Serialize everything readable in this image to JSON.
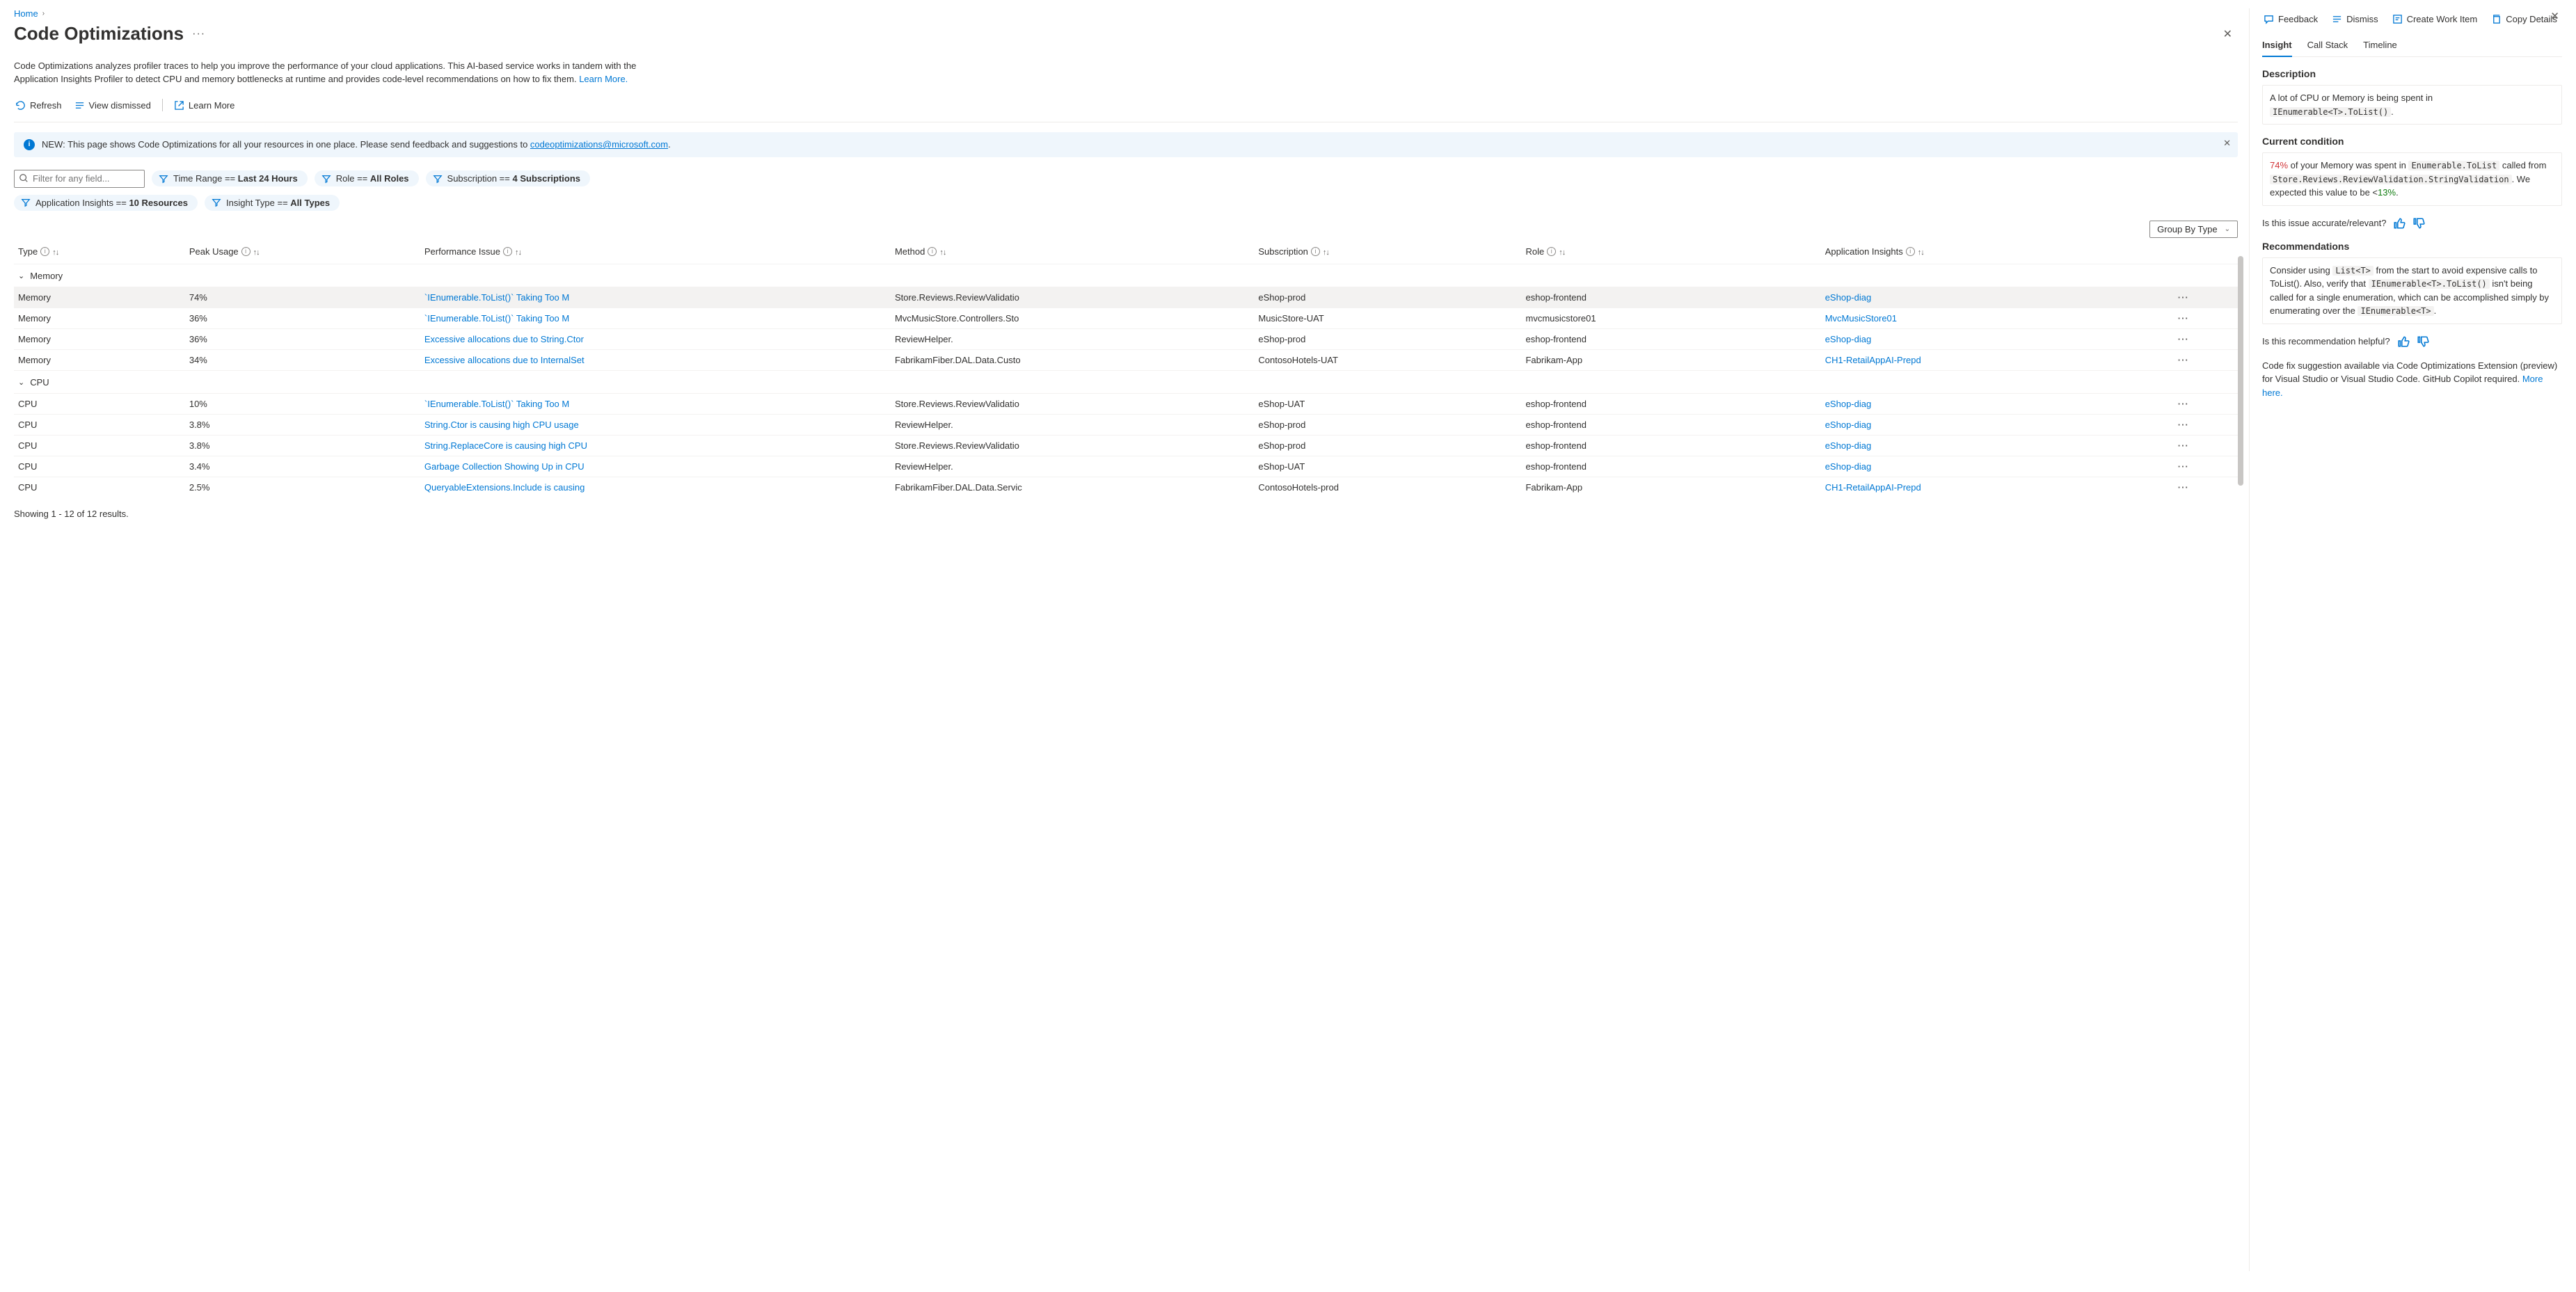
{
  "breadcrumb": {
    "home": "Home"
  },
  "title": "Code Optimizations",
  "intro_text": "Code Optimizations analyzes profiler traces to help you improve the performance of your cloud applications. This AI-based service works in tandem with the Application Insights Profiler to detect CPU and memory bottlenecks at runtime and provides code-level recommendations on how to fix them.",
  "learn_more": "Learn More.",
  "toolbar": {
    "refresh": "Refresh",
    "view_dismissed": "View dismissed",
    "learn_more": "Learn More"
  },
  "banner": {
    "prefix": "NEW: This page shows Code Optimizations for all your resources in one place. Please send feedback and suggestions to ",
    "email": "codeoptimizations@microsoft.com",
    "suffix": "."
  },
  "filters": {
    "search_placeholder": "Filter for any field...",
    "time_range_label": "Time Range ==",
    "time_range_value": "Last 24 Hours",
    "role_label": "Role ==",
    "role_value": "All Roles",
    "subscription_label": "Subscription ==",
    "subscription_value": "4 Subscriptions",
    "appinsights_label": "Application Insights ==",
    "appinsights_value": "10 Resources",
    "insight_type_label": "Insight Type ==",
    "insight_type_value": "All Types"
  },
  "group_by": "Group By Type",
  "columns": {
    "type": "Type",
    "peak": "Peak Usage",
    "issue": "Performance Issue",
    "method": "Method",
    "subscription": "Subscription",
    "role": "Role",
    "appinsights": "Application Insights"
  },
  "groups": {
    "memory": "Memory",
    "cpu": "CPU"
  },
  "rows_memory": [
    {
      "type": "Memory",
      "peak": "74%",
      "issue": "`IEnumerable<T>.ToList()` Taking Too M",
      "method": "Store.Reviews.ReviewValidatio",
      "sub": "eShop-prod",
      "role": "eshop-frontend",
      "ai": "eShop-diag"
    },
    {
      "type": "Memory",
      "peak": "36%",
      "issue": "`IEnumerable<T>.ToList()` Taking Too M",
      "method": "MvcMusicStore.Controllers.Sto",
      "sub": "MusicStore-UAT",
      "role": "mvcmusicstore01",
      "ai": "MvcMusicStore01"
    },
    {
      "type": "Memory",
      "peak": "36%",
      "issue": "Excessive allocations due to String.Ctor",
      "method": "ReviewHelper.<LoadDisallowe",
      "sub": "eShop-prod",
      "role": "eshop-frontend",
      "ai": "eShop-diag"
    },
    {
      "type": "Memory",
      "peak": "34%",
      "issue": "Excessive allocations due to InternalSet",
      "method": "FabrikamFiber.DAL.Data.Custo",
      "sub": "ContosoHotels-UAT",
      "role": "Fabrikam-App",
      "ai": "CH1-RetailAppAI-Prepd"
    }
  ],
  "rows_cpu": [
    {
      "type": "CPU",
      "peak": "10%",
      "issue": "`IEnumerable<T>.ToList()` Taking Too M",
      "method": "Store.Reviews.ReviewValidatio",
      "sub": "eShop-UAT",
      "role": "eshop-frontend",
      "ai": "eShop-diag"
    },
    {
      "type": "CPU",
      "peak": "3.8%",
      "issue": "String.Ctor is causing high CPU usage",
      "method": "ReviewHelper.<LoadDisallowe",
      "sub": "eShop-prod",
      "role": "eshop-frontend",
      "ai": "eShop-diag"
    },
    {
      "type": "CPU",
      "peak": "3.8%",
      "issue": "String.ReplaceCore is causing high CPU",
      "method": "Store.Reviews.ReviewValidatio",
      "sub": "eShop-prod",
      "role": "eshop-frontend",
      "ai": "eShop-diag"
    },
    {
      "type": "CPU",
      "peak": "3.4%",
      "issue": "Garbage Collection Showing Up in CPU",
      "method": "ReviewHelper.<LoadDisallowe",
      "sub": "eShop-UAT",
      "role": "eshop-frontend",
      "ai": "eShop-diag"
    },
    {
      "type": "CPU",
      "peak": "2.5%",
      "issue": "QueryableExtensions.Include is causing",
      "method": "FabrikamFiber.DAL.Data.Servic",
      "sub": "ContosoHotels-prod",
      "role": "Fabrikam-App",
      "ai": "CH1-RetailAppAI-Prepd"
    }
  ],
  "results_text": "Showing 1 - 12 of 12 results.",
  "side": {
    "feedback": "Feedback",
    "dismiss": "Dismiss",
    "create_work_item": "Create Work Item",
    "copy_details": "Copy Details",
    "tabs": {
      "insight": "Insight",
      "call_stack": "Call Stack",
      "timeline": "Timeline"
    },
    "desc_h": "Description",
    "desc_text": "A lot of CPU or Memory is being spent in ",
    "desc_code": "IEnumerable<T>.ToList()",
    "cond_h": "Current condition",
    "cond_pct": "74%",
    "cond_text1": " of your Memory was spent in ",
    "cond_code1": "Enumerable.ToList",
    "cond_text2": " called from ",
    "cond_code2": "Store.Reviews.ReviewValidation.StringValidation",
    "cond_text3": ". We expected this value to be <",
    "cond_pct2": "13%",
    "accurate_q": "Is this issue accurate/relevant?",
    "rec_h": "Recommendations",
    "rec_text1": "Consider using ",
    "rec_code1": "List<T>",
    "rec_text2": " from the start to avoid expensive calls to ToList(). Also, verify that ",
    "rec_code2": "IEnumerable<T>.ToList()",
    "rec_text3": " isn't being called for a single enumeration, which can be accomplished simply by enumerating over the ",
    "rec_code3": "IEnumerable<T>",
    "helpful_q": "Is this recommendation helpful?",
    "fix_note": "Code fix suggestion available via Code Optimizations Extension (preview) for Visual Studio or Visual Studio Code. GitHub Copilot required. ",
    "more_here": "More here."
  }
}
